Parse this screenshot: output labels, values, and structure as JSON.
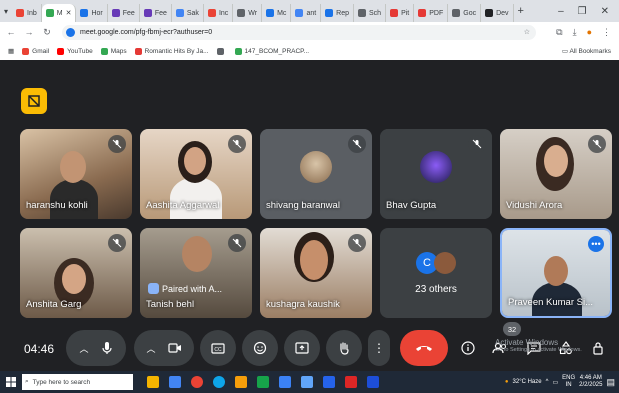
{
  "browser": {
    "tabs": [
      {
        "label": "Inb",
        "color": "#ea4335"
      },
      {
        "label": "M",
        "color": "#34a853",
        "active": true
      },
      {
        "label": "Hor",
        "color": "#1a73e8"
      },
      {
        "label": "Fee",
        "color": "#673ab7"
      },
      {
        "label": "Fee",
        "color": "#673ab7"
      },
      {
        "label": "Sak",
        "color": "#4285f4"
      },
      {
        "label": "Inc",
        "color": "#ea4335"
      },
      {
        "label": "Wr",
        "color": "#5f6368"
      },
      {
        "label": "Mc",
        "color": "#1a73e8"
      },
      {
        "label": "ant",
        "color": "#4285f4"
      },
      {
        "label": "Rep",
        "color": "#1a73e8"
      },
      {
        "label": "Sch",
        "color": "#5f6368"
      },
      {
        "label": "Pit",
        "color": "#e53935"
      },
      {
        "label": "PDF",
        "color": "#e53935"
      },
      {
        "label": "Goc",
        "color": "#5f6368"
      },
      {
        "label": "Dev",
        "color": "#202124"
      }
    ],
    "url": "meet.google.com/pfg-fbmj-ecr?authuser=0",
    "bookmarks": [
      {
        "label": "Gmail",
        "color": "#ea4335"
      },
      {
        "label": "YouTube",
        "color": "#ff0000"
      },
      {
        "label": "Maps",
        "color": "#34a853"
      },
      {
        "label": "Romantic Hits By Ja...",
        "color": "#e53935"
      },
      {
        "label": "",
        "color": "#5f6368"
      },
      {
        "label": "147_BCOM_PRACP...",
        "color": "#34a853"
      }
    ],
    "all_bookmarks": "All Bookmarks"
  },
  "participants": [
    {
      "name": "haranshu kohli",
      "bg": "#b08a6a"
    },
    {
      "name": "Aashita Aggarwal",
      "bg": "#a98266"
    },
    {
      "name": "shivang baranwal",
      "bg": "#5a5e63"
    },
    {
      "name": "Bhav Gupta",
      "bg": "#3c4043"
    },
    {
      "name": "Vidushi Arora",
      "bg": "#c4b7a8"
    },
    {
      "name": "Anshita Garg",
      "bg": "#8d7a66"
    },
    {
      "name": "Tanish behl",
      "bg": "#7a6f5e",
      "paired": "Paired with A..."
    },
    {
      "name": "kushagra kaushik",
      "bg": "#9b7e64"
    },
    {
      "name": "Praveen Kumar Si...",
      "bg": "#c8d0d6"
    }
  ],
  "others": {
    "label": "23 others",
    "avatar_letter": "C"
  },
  "controls": {
    "time": "04:46",
    "people_count": "32"
  },
  "activate_windows": {
    "title": "Activate Windows",
    "sub": "Go to Settings to activate Windows."
  },
  "taskbar": {
    "search_placeholder": "Type here to search",
    "weather": "32°C Haze",
    "lang": "ENG",
    "lang_region": "IN",
    "clock_time": "4:46 AM",
    "clock_date": "2/2/2025"
  },
  "colors": {
    "end_call": "#ea4335",
    "meet_bg": "#202124",
    "accent": "#8ab4f8"
  }
}
